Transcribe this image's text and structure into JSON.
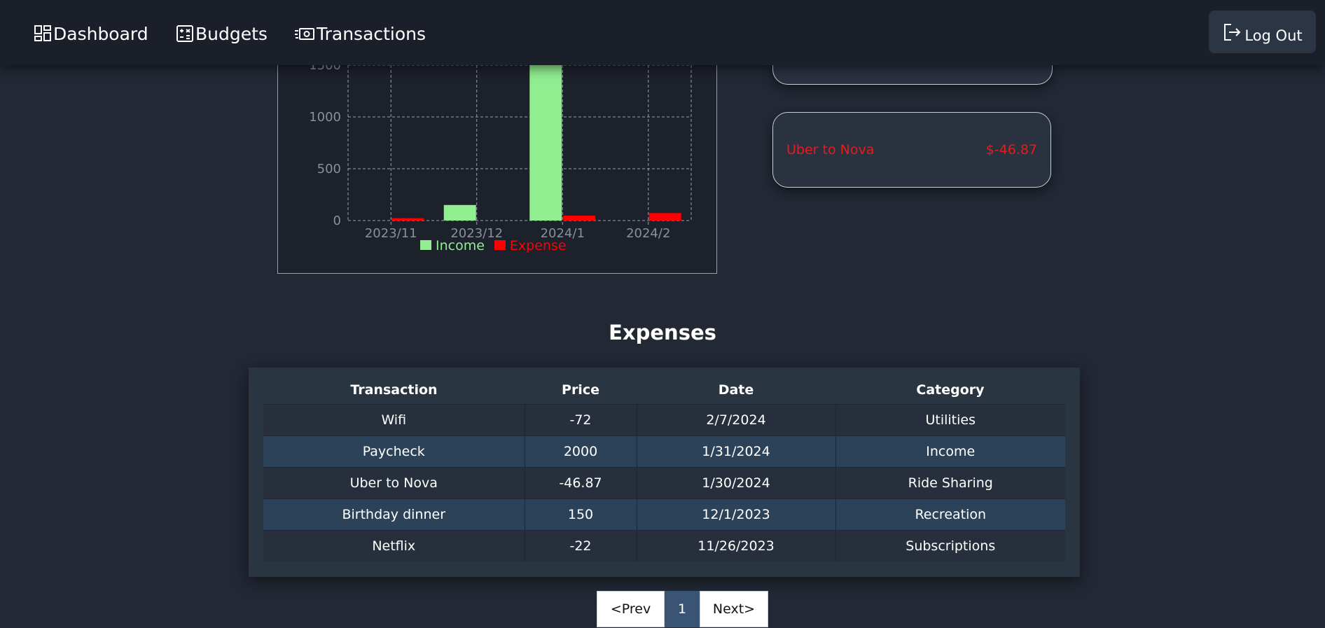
{
  "nav": {
    "items": [
      {
        "label": "Dashboard",
        "icon": "dashboard-icon"
      },
      {
        "label": "Budgets",
        "icon": "calculator-icon"
      },
      {
        "label": "Transactions",
        "icon": "money-icon"
      }
    ],
    "logout_label": "Log Out"
  },
  "chart_data": {
    "type": "bar",
    "categories": [
      "2023/11",
      "2023/12",
      "2024/1",
      "2024/2"
    ],
    "series": [
      {
        "name": "Income",
        "values": [
          0,
          150,
          2000,
          0
        ],
        "color": "#90ee90"
      },
      {
        "name": "Expense",
        "values": [
          22,
          0,
          46.87,
          72
        ],
        "color": "#ff0000"
      }
    ],
    "yticks": [
      0,
      500,
      1000,
      1500
    ],
    "ylim": [
      0,
      1500
    ],
    "grid": true,
    "legend_position": "bottom"
  },
  "recent": [
    {
      "name": "Uber to Nova",
      "amount": "$-46.87"
    }
  ],
  "expenses": {
    "title": "Expenses",
    "columns": [
      "Transaction",
      "Price",
      "Date",
      "Category"
    ],
    "rows": [
      [
        "Wifi",
        "-72",
        "2/7/2024",
        "Utilities"
      ],
      [
        "Paycheck",
        "2000",
        "1/31/2024",
        "Income"
      ],
      [
        "Uber to Nova",
        "-46.87",
        "1/30/2024",
        "Ride Sharing"
      ],
      [
        "Birthday dinner",
        "150",
        "12/1/2023",
        "Recreation"
      ],
      [
        "Netflix",
        "-22",
        "11/26/2023",
        "Subscriptions"
      ]
    ]
  },
  "pagination": {
    "prev": "<Prev",
    "current": "1",
    "next": "Next>"
  },
  "colors": {
    "income": "#90ee90",
    "expense": "#ff0000",
    "background": "#222834",
    "nav": "#1b1f2a"
  }
}
